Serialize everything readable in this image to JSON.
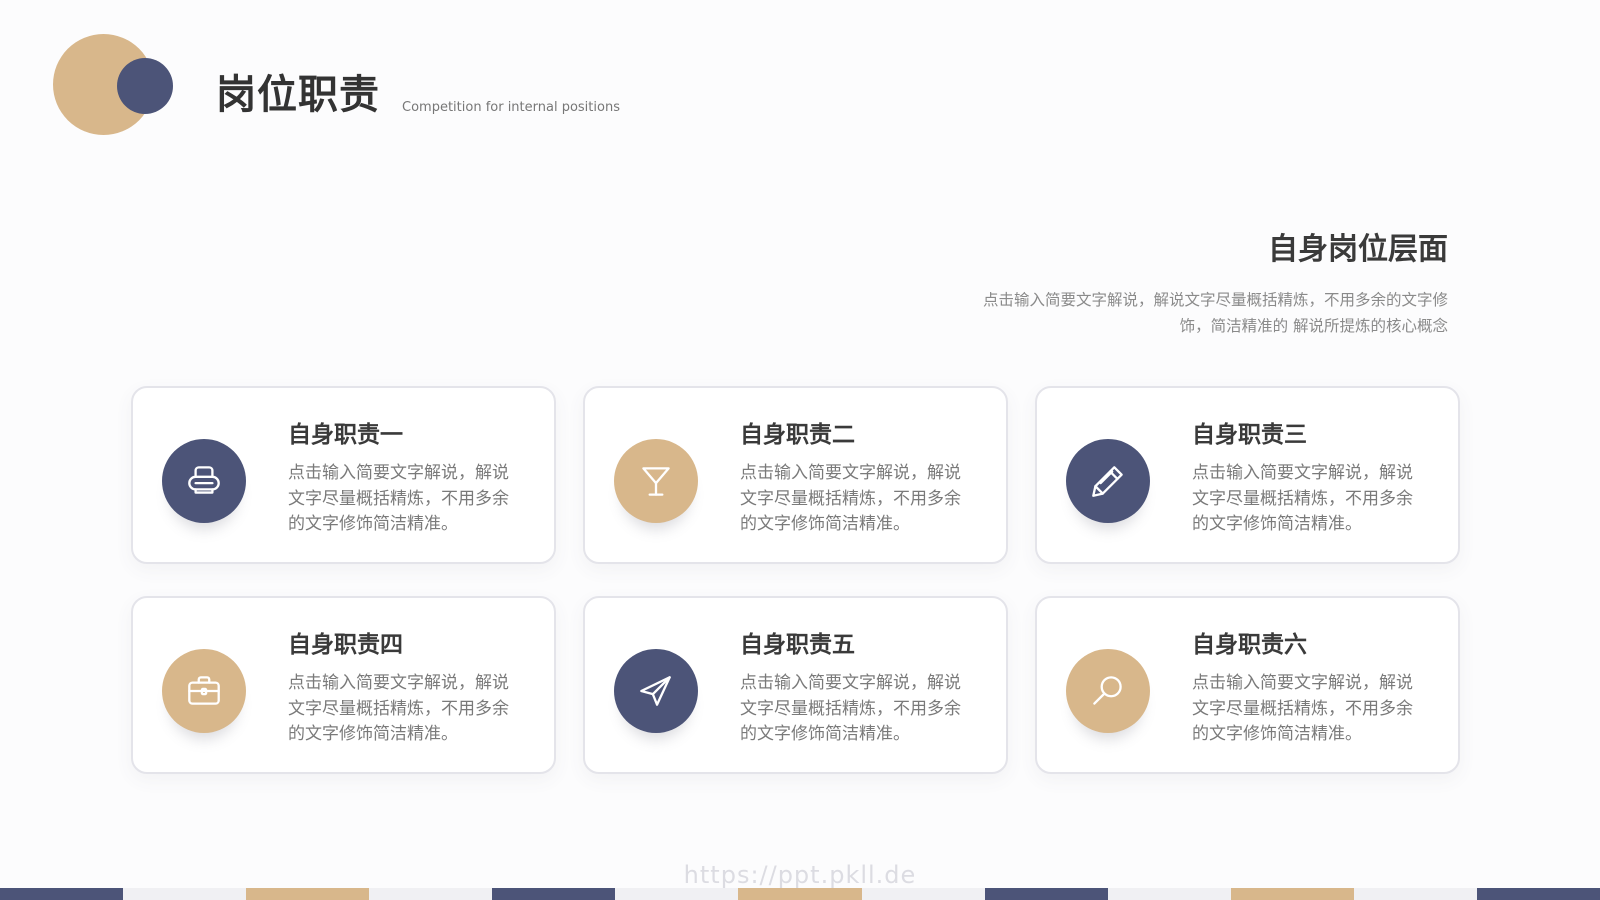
{
  "header": {
    "title": "岗位职责",
    "subtitle": "Competition for internal positions"
  },
  "section": {
    "title": "自身岗位层面",
    "description": "点击输入简要文字解说，解说文字尽量概括精炼，不用多余的文字修饰，简洁精准的 解说所提炼的核心概念"
  },
  "cards": [
    {
      "title": "自身职责一",
      "description": "点击输入简要文字解说，解说文字尽量概括精炼，不用多余的文字修饰简洁精准。",
      "icon": "printer-icon",
      "color": "#4c5478"
    },
    {
      "title": "自身职责二",
      "description": "点击输入简要文字解说，解说文字尽量概括精炼，不用多余的文字修饰简洁精准。",
      "icon": "cocktail-glass-icon",
      "color": "#d8b78b"
    },
    {
      "title": "自身职责三",
      "description": "点击输入简要文字解说，解说文字尽量概括精炼，不用多余的文字修饰简洁精准。",
      "icon": "pencil-icon",
      "color": "#4c5478"
    },
    {
      "title": "自身职责四",
      "description": "点击输入简要文字解说，解说文字尽量概括精炼，不用多余的文字修饰简洁精准。",
      "icon": "briefcase-icon",
      "color": "#d8b78b"
    },
    {
      "title": "自身职责五",
      "description": "点击输入简要文字解说，解说文字尽量概括精炼，不用多余的文字修饰简洁精准。",
      "icon": "paper-plane-icon",
      "color": "#4c5478"
    },
    {
      "title": "自身职责六",
      "description": "点击输入简要文字解说，解说文字尽量概括精炼，不用多余的文字修饰简洁精准。",
      "icon": "magnifier-icon",
      "color": "#d8b78b"
    }
  ],
  "colors": {
    "navy": "#4c5478",
    "tan": "#d8b78b",
    "light": "#f0f0f3"
  },
  "watermark": "https://ppt.pkll.de"
}
